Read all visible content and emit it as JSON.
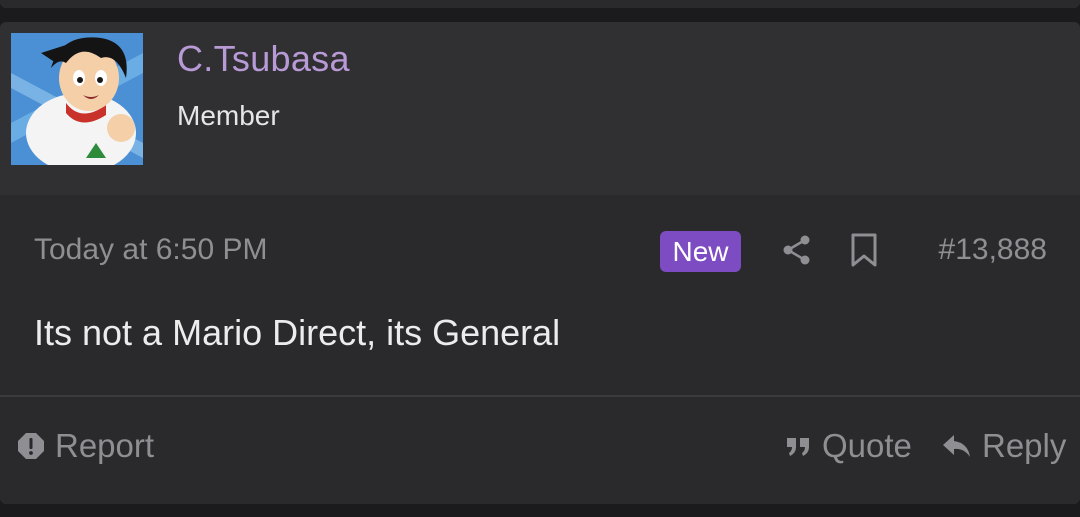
{
  "user": {
    "name": "C.Tsubasa",
    "title": "Member"
  },
  "post": {
    "time": "Today at 6:50 PM",
    "badge": "New",
    "number": "#13,888",
    "message": "Its not a Mario Direct, its General"
  },
  "actions": {
    "report": "Report",
    "quote": "Quote",
    "reply": "Reply"
  },
  "colors": {
    "username": "#b79ad6",
    "badge": "#7d4cc2",
    "muted": "#8e8e93"
  },
  "icons": [
    "share-icon",
    "bookmark-icon",
    "report-icon",
    "quote-icon",
    "reply-icon"
  ]
}
